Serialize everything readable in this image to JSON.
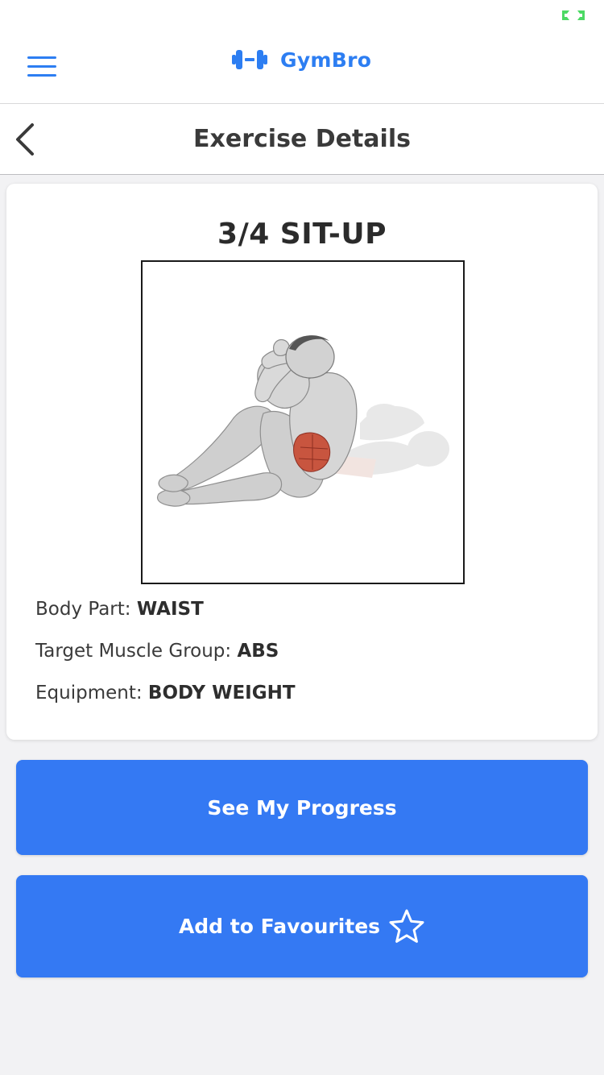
{
  "app": {
    "name": "GymBro",
    "accent_color": "#2d7ef2",
    "button_color": "#3479f3"
  },
  "status_bar": {
    "battery_icon": "battery-charging-icon",
    "battery_color": "#4cd964"
  },
  "header": {
    "menu_icon": "hamburger-menu-icon",
    "brand_icon": "dumbbell-icon"
  },
  "title_bar": {
    "back_icon": "chevron-left-icon",
    "title": "Exercise Details"
  },
  "exercise": {
    "name": "3/4 SIT-UP",
    "image_alt": "3/4 sit-up illustration",
    "body_part_label": "Body Part:",
    "body_part": "WAIST",
    "target_label": "Target Muscle Group:",
    "target": "ABS",
    "equipment_label": "Equipment:",
    "equipment": "BODY WEIGHT"
  },
  "actions": {
    "progress_label": "See My Progress",
    "favourites_label": "Add to Favourites",
    "favourites_icon": "star-outline-icon"
  }
}
